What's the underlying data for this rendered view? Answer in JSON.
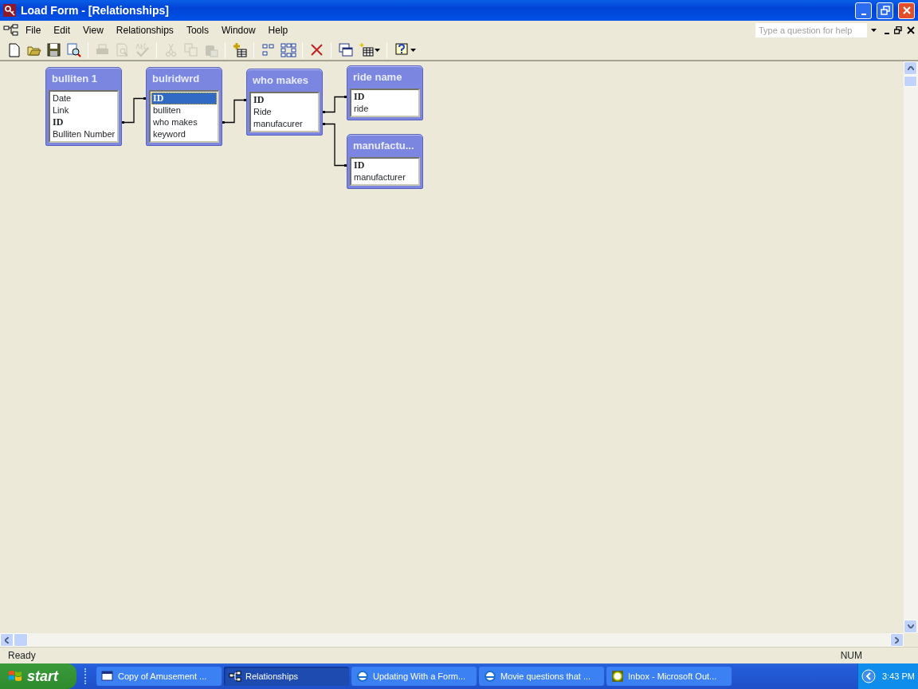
{
  "window": {
    "title": "Load Form - [Relationships]"
  },
  "menu": [
    "File",
    "Edit",
    "View",
    "Relationships",
    "Tools",
    "Window",
    "Help"
  ],
  "help_search": {
    "placeholder": "Type a question for help"
  },
  "toolbar": [
    [
      {
        "kind": "new",
        "disabled": false
      },
      {
        "kind": "open",
        "disabled": false
      },
      {
        "kind": "save",
        "disabled": false
      },
      {
        "kind": "search",
        "disabled": false
      }
    ],
    [
      {
        "kind": "print",
        "disabled": true
      },
      {
        "kind": "preview",
        "disabled": true
      },
      {
        "kind": "spelling",
        "disabled": true
      }
    ],
    [
      {
        "kind": "cut",
        "disabled": true
      },
      {
        "kind": "copy",
        "disabled": true
      },
      {
        "kind": "paste",
        "disabled": true
      }
    ],
    [
      {
        "kind": "show_table",
        "disabled": false
      }
    ],
    [
      {
        "kind": "direct",
        "disabled": false
      },
      {
        "kind": "all",
        "disabled": false
      }
    ],
    [
      {
        "kind": "delete",
        "disabled": false
      }
    ],
    [
      {
        "kind": "window",
        "disabled": false
      },
      {
        "kind": "new_object",
        "disabled": false
      }
    ],
    [
      {
        "kind": "help",
        "disabled": false
      }
    ]
  ],
  "tables": [
    {
      "title": "bulliten 1",
      "fields": [
        {
          "name": "Date",
          "primary_key": false,
          "selected": false
        },
        {
          "name": "Link",
          "primary_key": false,
          "selected": false
        },
        {
          "name": "ID",
          "primary_key": true,
          "selected": false
        },
        {
          "name": "Bulliten Number",
          "primary_key": false,
          "selected": false
        }
      ]
    },
    {
      "title": "bulridwrd",
      "fields": [
        {
          "name": "ID",
          "primary_key": true,
          "selected": true
        },
        {
          "name": "bulliten",
          "primary_key": false,
          "selected": false
        },
        {
          "name": "who makes",
          "primary_key": false,
          "selected": false
        },
        {
          "name": "keyword",
          "primary_key": false,
          "selected": false
        }
      ]
    },
    {
      "title": "who makes",
      "fields": [
        {
          "name": "ID",
          "primary_key": true,
          "selected": false
        },
        {
          "name": "Ride",
          "primary_key": false,
          "selected": false
        },
        {
          "name": "manufacurer",
          "primary_key": false,
          "selected": false
        }
      ]
    },
    {
      "title": "ride name",
      "fields": [
        {
          "name": "ID",
          "primary_key": true,
          "selected": false
        },
        {
          "name": "ride",
          "primary_key": false,
          "selected": false
        }
      ]
    },
    {
      "title": "manufactu...",
      "fields": [
        {
          "name": "ID",
          "primary_key": true,
          "selected": false
        },
        {
          "name": "manufacturer",
          "primary_key": false,
          "selected": false
        }
      ]
    }
  ],
  "status_bar": {
    "text": "Ready",
    "indicator": "NUM"
  },
  "taskbar": {
    "start": "start",
    "tasks": [
      {
        "label": "Copy of Amusement ...",
        "kind": "access",
        "selected": false
      },
      {
        "label": "Relationships",
        "kind": "relationships",
        "selected": true
      },
      {
        "label": "Updating With a Form...",
        "kind": "browser",
        "selected": false
      },
      {
        "label": "Movie questions that ...",
        "kind": "browser",
        "selected": false
      },
      {
        "label": "Inbox - Microsoft Out...",
        "kind": "outlook",
        "selected": false
      }
    ],
    "clock": "3:43 PM"
  }
}
